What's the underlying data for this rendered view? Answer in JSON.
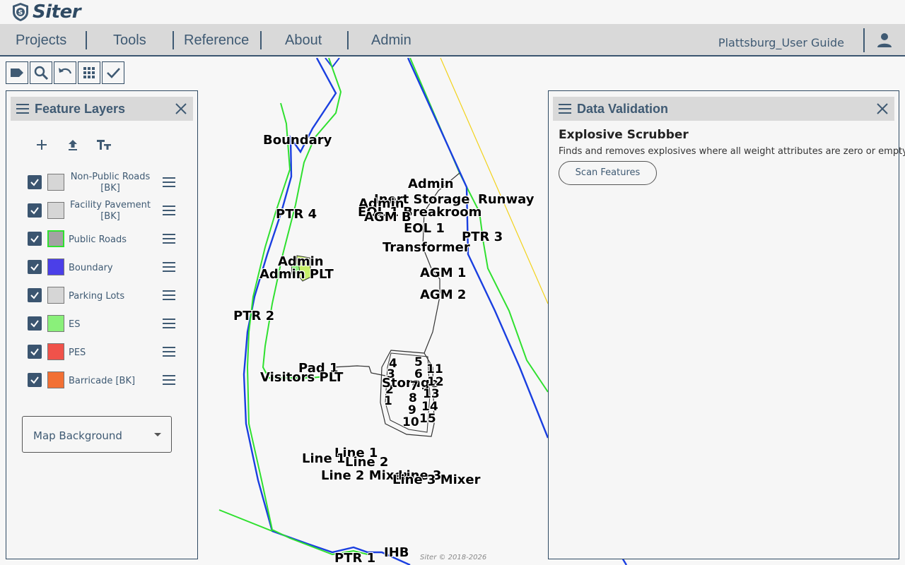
{
  "app": {
    "name": "Siter"
  },
  "menu": {
    "items": [
      "Projects",
      "Tools",
      "Reference",
      "About",
      "Admin"
    ],
    "project_name": "Plattsburg_User Guide"
  },
  "toolbar": {
    "tools": [
      "label-icon",
      "search-icon",
      "undo-icon",
      "grid-icon",
      "check-icon"
    ]
  },
  "layers_panel": {
    "title": "Feature Layers",
    "tools": [
      "add-icon",
      "upload-icon",
      "text-size-icon"
    ],
    "layers": [
      {
        "name": "Non-Public Roads [BK]",
        "color": "#d6d6d6",
        "checked": true
      },
      {
        "name": "Facility Pavement [BK]",
        "color": "#d6d6d6",
        "checked": true
      },
      {
        "name": "Public Roads",
        "color": "#a3a3a3",
        "checked": true
      },
      {
        "name": "Boundary",
        "color": "#4b3fe8",
        "checked": true
      },
      {
        "name": "Parking Lots",
        "color": "#d6d6d6",
        "checked": true
      },
      {
        "name": "ES",
        "color": "#8af07a",
        "checked": true
      },
      {
        "name": "PES",
        "color": "#f0524a",
        "checked": true
      },
      {
        "name": "Barricade [BK]",
        "color": "#f27034",
        "checked": true
      }
    ],
    "map_background": {
      "label": "Map Background"
    }
  },
  "validation_panel": {
    "title": "Data Validation",
    "tool_title": "Explosive Scrubber",
    "tool_desc": "Finds and removes explosives where all weight attributes are zero or empty.",
    "scan_label": "Scan Features"
  },
  "map": {
    "labels": [
      "Boundary",
      "PTR 4",
      "Admin",
      "Inert Storage",
      "Admin",
      "EOL 1 Breakroom",
      "AGM B",
      "Runway",
      "EOL 1",
      "PTR 3",
      "Transformer",
      "Admin",
      "Admin PLT",
      "AGM 1",
      "AGM 2",
      "PTR 2",
      "Pad 1",
      "Visitors PLT",
      "4",
      "3",
      "2",
      "1",
      "5",
      "6",
      "11",
      "Storage",
      "12",
      "7",
      "8",
      "13",
      "9",
      "14",
      "10",
      "15",
      "Line 1",
      "Line 1",
      "Line 2",
      "Line 2 Mixer",
      "Line 3",
      "Line 3 Mixer",
      "PTR 1",
      "IHB"
    ],
    "copyright": "Siter © 2018-2026"
  }
}
